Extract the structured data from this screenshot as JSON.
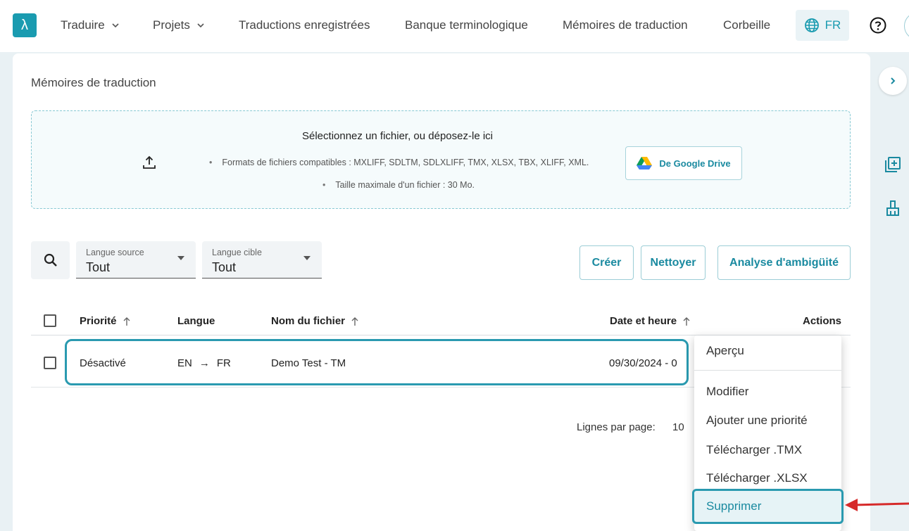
{
  "nav": {
    "logo_glyph": "λ",
    "items": [
      {
        "label": "Traduire",
        "dropdown": true
      },
      {
        "label": "Projets",
        "dropdown": true
      },
      {
        "label": "Traductions enregistrées"
      },
      {
        "label": "Banque terminologique"
      },
      {
        "label": "Mémoires de traduction"
      },
      {
        "label": "Corbeille"
      }
    ],
    "language": "FR"
  },
  "page": {
    "title": "Mémoires de traduction"
  },
  "upload": {
    "title": "Sélectionnez un fichier, ou déposez-le ici",
    "formats": "Formats de fichiers compatibles : MXLIFF, SDLTM, SDLXLIFF, TMX, XLSX, TBX, XLIFF, XML.",
    "max_size": "Taille maximale d'un fichier : 30 Mo.",
    "gdrive_label": "De Google Drive"
  },
  "filters": {
    "source": {
      "label": "Langue source",
      "value": "Tout"
    },
    "target": {
      "label": "Langue cible",
      "value": "Tout"
    }
  },
  "actions": {
    "create": "Créer",
    "clean": "Nettoyer",
    "ambiguity": "Analyse d'ambigüité"
  },
  "table": {
    "headers": {
      "priority": "Priorité",
      "language": "Langue",
      "filename": "Nom du fichier",
      "datetime": "Date et heure",
      "actions": "Actions"
    },
    "rows": [
      {
        "priority": "Désactivé",
        "source_lang": "EN",
        "arrow": "→",
        "target_lang": "FR",
        "filename": "Demo Test - TM",
        "datetime": "09/30/2024 - 0"
      }
    ]
  },
  "pagination": {
    "rows_per_page_label": "Lignes par page:",
    "rows_per_page_value": "10"
  },
  "menu": {
    "items": [
      "Aperçu",
      "Modifier",
      "Ajouter une priorité",
      "Télécharger .TMX",
      "Télécharger .XLSX",
      "Supprimer"
    ],
    "highlighted": "Supprimer"
  },
  "colors": {
    "accent": "#1a9bb0",
    "highlight_border": "#2a9ab0",
    "annotation_arrow": "#d62a2a"
  }
}
